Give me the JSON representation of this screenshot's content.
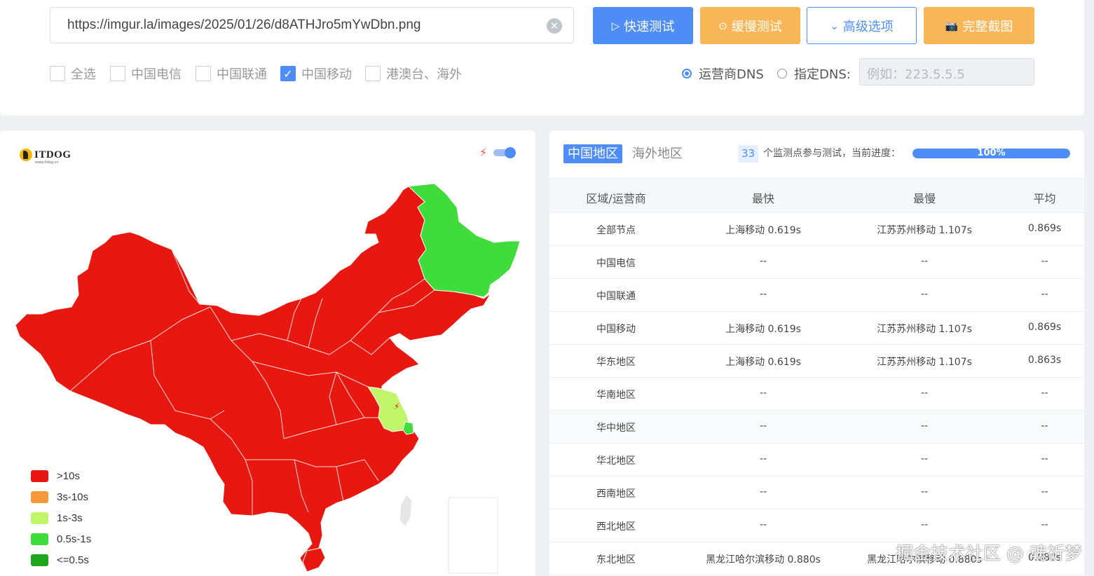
{
  "toolbar": {
    "url": "https://imgur.la/images/2025/01/26/d8ATHJro5mYwDbn.png",
    "clear_icon": "close-circle-icon",
    "fast_test": "快速测试",
    "slow_test": "缓慢测试",
    "advanced": "高级选项",
    "screenshot": "完整截图"
  },
  "filters": {
    "select_all": "全选",
    "telecom": "中国电信",
    "unicom": "中国联通",
    "mobile": "中国移动",
    "overseas": "港澳台、海外",
    "checked": [
      "中国移动"
    ]
  },
  "dns": {
    "isp_dns": "运营商DNS",
    "custom_dns": "指定DNS:",
    "placeholder": "例如：223.5.5.5",
    "selected": "运营商DNS"
  },
  "map": {
    "logo_text": "ITDOG",
    "logo_sub": "www.itdog.cn",
    "legend": [
      {
        "label": ">10s",
        "color": "#e8170f"
      },
      {
        "label": "3s-10s",
        "color": "#f7983a"
      },
      {
        "label": "1s-3s",
        "color": "#c0f56a"
      },
      {
        "label": "0.5s-1s",
        "color": "#3fdc3c"
      },
      {
        "label": "<=0.5s",
        "color": "#1ea61c"
      }
    ]
  },
  "results": {
    "tab_china": "中国地区",
    "tab_overseas": "海外地区",
    "node_count": "33",
    "count_text": "个监测点参与测试，当前进度：",
    "progress": "100%",
    "progress_value": 100,
    "headers": [
      "区域/运营商",
      "最快",
      "最慢",
      "平均"
    ],
    "rows": [
      {
        "region": "全部节点",
        "fastest": "上海移动 0.619s",
        "slowest": "江苏苏州移动 1.107s",
        "avg": "0.869s"
      },
      {
        "region": "中国电信",
        "fastest": "--",
        "slowest": "--",
        "avg": "--"
      },
      {
        "region": "中国联通",
        "fastest": "--",
        "slowest": "--",
        "avg": "--"
      },
      {
        "region": "中国移动",
        "fastest": "上海移动 0.619s",
        "slowest": "江苏苏州移动 1.107s",
        "avg": "0.869s"
      },
      {
        "region": "华东地区",
        "fastest": "上海移动 0.619s",
        "slowest": "江苏苏州移动 1.107s",
        "avg": "0.863s"
      },
      {
        "region": "华南地区",
        "fastest": "--",
        "slowest": "--",
        "avg": "--"
      },
      {
        "region": "华中地区",
        "fastest": "--",
        "slowest": "--",
        "avg": "--"
      },
      {
        "region": "华北地区",
        "fastest": "--",
        "slowest": "--",
        "avg": "--"
      },
      {
        "region": "西南地区",
        "fastest": "--",
        "slowest": "--",
        "avg": "--"
      },
      {
        "region": "西北地区",
        "fastest": "--",
        "slowest": "--",
        "avg": "--"
      },
      {
        "region": "东北地区",
        "fastest": "黑龙江哈尔滨移动 0.880s",
        "slowest": "黑龙江哈尔滨移动 0.880s",
        "avg": "0.880s"
      }
    ]
  },
  "watermark": "掘金技术社区 @ 魂祈梦"
}
